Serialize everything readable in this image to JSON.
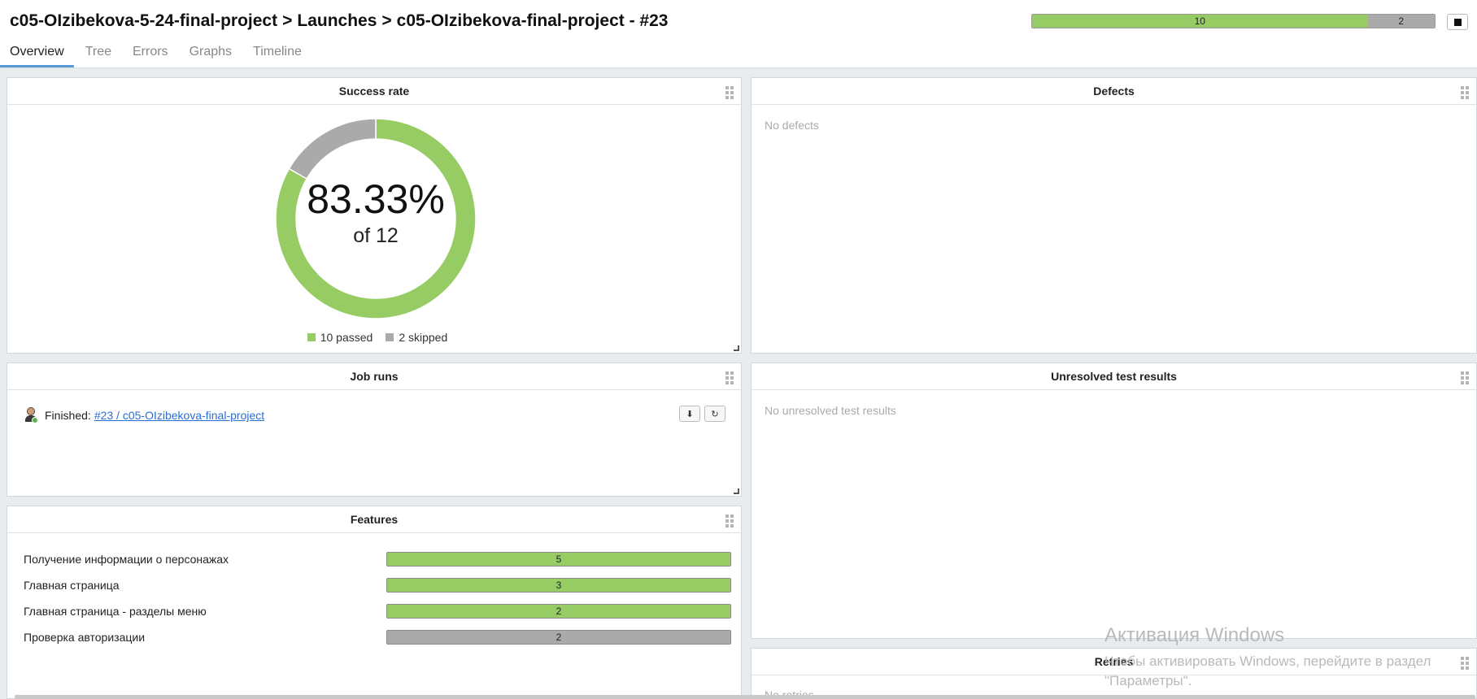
{
  "breadcrumb": {
    "project": "c05-OIzibekova-5-24-final-project",
    "section": "Launches",
    "launch": "c05-OIzibekova-final-project - #23",
    "separator": ">"
  },
  "tabs": [
    "Overview",
    "Tree",
    "Errors",
    "Graphs",
    "Timeline"
  ],
  "active_tab": "Overview",
  "summary_bar": {
    "passed": 10,
    "skipped": 2,
    "passed_label": "10",
    "skipped_label": "2"
  },
  "colors": {
    "passed": "#97cc64",
    "skipped": "#aaaaaa",
    "link": "#2a6fd6"
  },
  "success_rate": {
    "title": "Success rate",
    "percent_text": "83.33%",
    "of_text": "of 12",
    "legend": [
      {
        "label": "10 passed",
        "color": "#97cc64"
      },
      {
        "label": "2 skipped",
        "color": "#aaaaaa"
      }
    ]
  },
  "chart_data": {
    "type": "pie",
    "categories": [
      "passed",
      "skipped"
    ],
    "values": [
      10,
      2
    ],
    "title": "Success rate"
  },
  "defects": {
    "title": "Defects",
    "empty": "No defects"
  },
  "job_runs": {
    "title": "Job runs",
    "status": "Finished:",
    "link": "#23 / c05-OIzibekova-final-project",
    "buttons": {
      "download": "⬇",
      "refresh": "↻"
    }
  },
  "unresolved": {
    "title": "Unresolved test results",
    "empty": "No unresolved test results"
  },
  "features": {
    "title": "Features",
    "items": [
      {
        "name": "Получение информации о персонажах",
        "count": "5",
        "status": "passed"
      },
      {
        "name": "Главная страница",
        "count": "3",
        "status": "passed"
      },
      {
        "name": "Главная страница - разделы меню",
        "count": "2",
        "status": "passed"
      },
      {
        "name": "Проверка авторизации",
        "count": "2",
        "status": "skipped"
      }
    ]
  },
  "retries": {
    "title": "Retries",
    "empty": "No retries"
  },
  "watermark": {
    "title": "Активация Windows",
    "subtitle": "Чтобы активировать Windows, перейдите в раздел \"Параметры\"."
  }
}
